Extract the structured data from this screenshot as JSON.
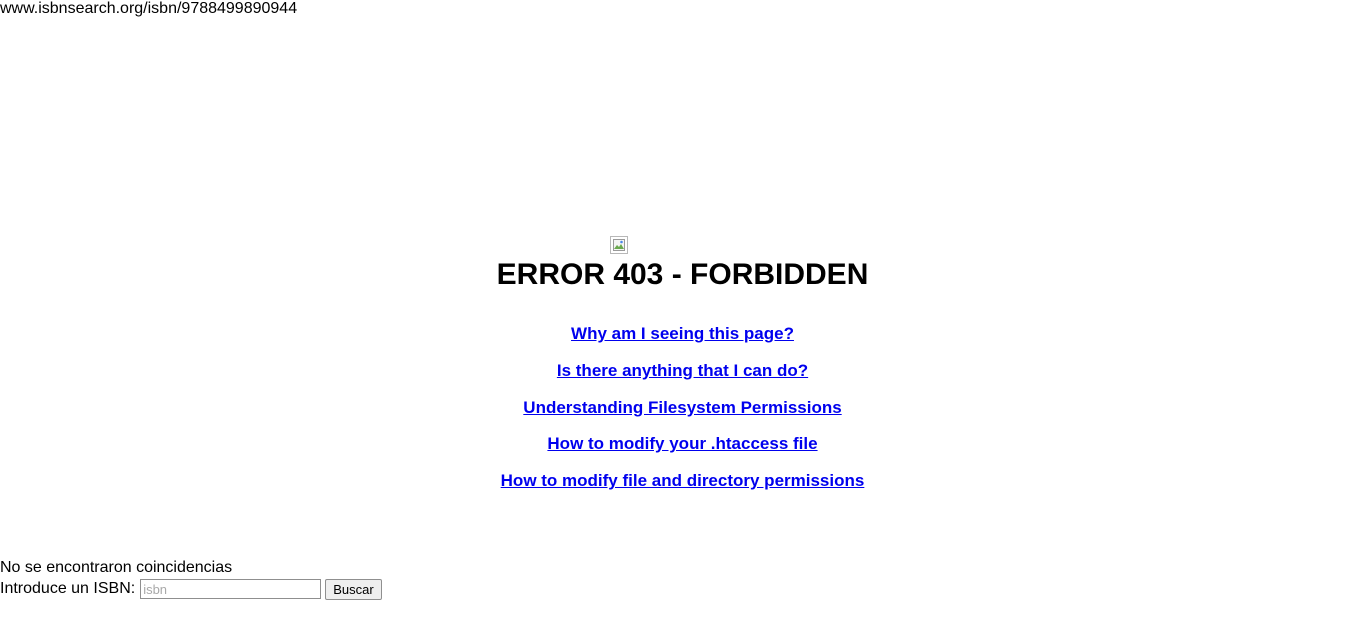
{
  "address": {
    "url_text": "www.isbnsearch.org/isbn/9788499890944"
  },
  "error": {
    "title": "ERROR 403 - FORBIDDEN",
    "links": [
      "Why am I seeing this page?",
      "Is there anything that I can do?",
      "Understanding Filesystem Permissions",
      "How to modify your .htaccess file",
      "How to modify file and directory permissions"
    ]
  },
  "search": {
    "status": "No se encontraron coincidencias",
    "label": "Introduce un ISBN:",
    "value": "",
    "placeholder": "isbn",
    "button_label": "Buscar"
  },
  "colors": {
    "link": "#0000ee",
    "text": "#000000",
    "background": "#ffffff"
  }
}
